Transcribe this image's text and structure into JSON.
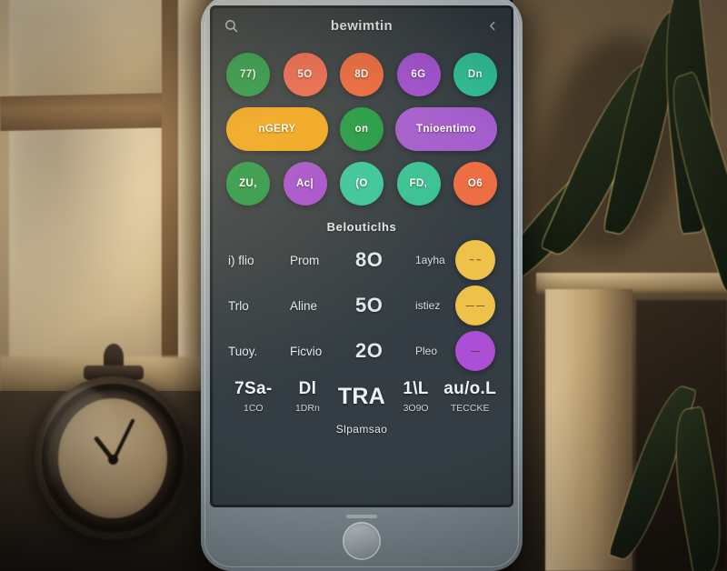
{
  "scene": {
    "description": "smartphone-on-windowsill-photo",
    "left_object": "vintage-analog-clock",
    "right_object": "snake-plant-leaves",
    "background": "window-with-wooden-frame"
  },
  "phone": {
    "body_color": "#aab4ba",
    "screen_bg": "#333d43"
  },
  "statusbar": {
    "left_icon": "search-icon",
    "right_icon": "chevron-left-icon"
  },
  "header": {
    "title": "bewimtin"
  },
  "tags": {
    "row1": [
      {
        "label": "77)",
        "color": "#27a04d",
        "shape": "circle"
      },
      {
        "label": "5O",
        "color": "#ef6b52",
        "shape": "circle"
      },
      {
        "label": "8D",
        "color": "#ee6a3f",
        "shape": "circle"
      },
      {
        "label": "6G",
        "color": "#a250d4",
        "shape": "circle"
      },
      {
        "label": "Dn",
        "color": "#2fc39a",
        "shape": "circle"
      }
    ],
    "row2": [
      {
        "label": "nGERY",
        "color": "#f0a71e",
        "shape": "pill"
      },
      {
        "label": "on",
        "color": "#1f9a45",
        "shape": "circle"
      },
      {
        "label": "Tnioentimo",
        "color": "#a35ccf",
        "shape": "pill"
      }
    ],
    "row3": [
      {
        "label": "ZU,",
        "color": "#25994a",
        "shape": "circle"
      },
      {
        "label": "Ac|",
        "color": "#a34fd1",
        "shape": "circle"
      },
      {
        "label": "(O",
        "color": "#36c79c",
        "shape": "circle"
      },
      {
        "label": "FD,",
        "color": "#35c295",
        "shape": "circle"
      },
      {
        "label": "O6",
        "color": "#ee6c42",
        "shape": "circle"
      }
    ]
  },
  "section": {
    "title": "Belouticlhs"
  },
  "list": {
    "rows": [
      {
        "c1": "i) flio",
        "c2": "Prom",
        "c3": "8O",
        "c4": "1ayha",
        "dot_color": "#edc14a",
        "dot_label": "~ ~"
      },
      {
        "c1": "Trlo",
        "c2": "Aline",
        "c3": "5O",
        "c4": "istiez",
        "dot_color": "#edc14a",
        "dot_label": "— —"
      },
      {
        "c1": "Tuoy.",
        "c2": "Ficvio",
        "c3": "2O",
        "c4": "Pleo",
        "dot_color": "#ab4fd5",
        "dot_label": "—"
      }
    ]
  },
  "summary": {
    "items": [
      {
        "value": "7Sa-",
        "sub": "1CO"
      },
      {
        "value": "Dl",
        "sub": "1DRn"
      },
      {
        "value": "TRA",
        "sub": ""
      },
      {
        "value": "1\\L",
        "sub": "3O9O"
      },
      {
        "value": "au/o.L",
        "sub": "TECCKE"
      }
    ],
    "footer": "Slpamsao"
  }
}
